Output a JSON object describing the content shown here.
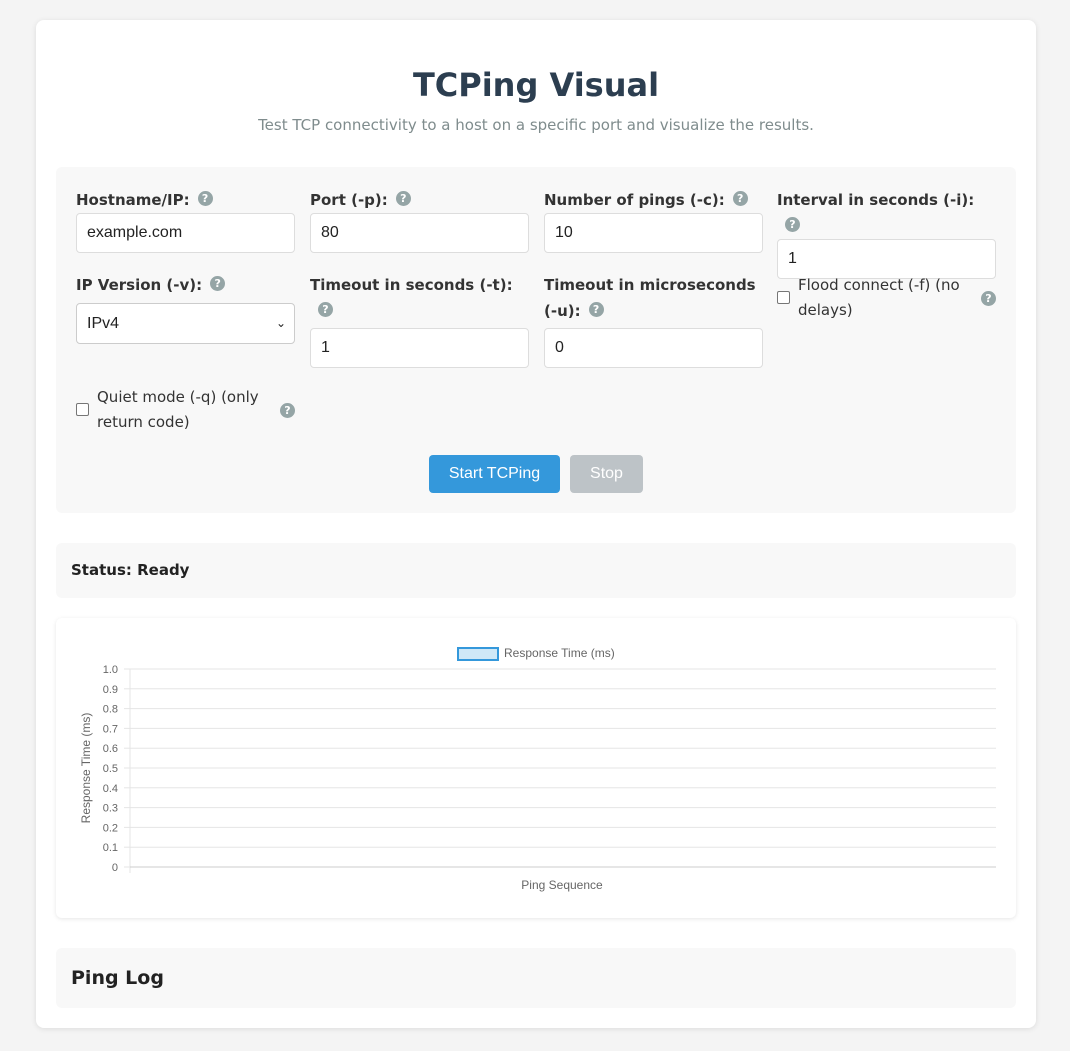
{
  "header": {
    "title": "TCPing Visual",
    "subtitle": "Test TCP connectivity to a host on a specific port and visualize the results."
  },
  "form": {
    "hostname": {
      "label": "Hostname/IP:",
      "value": "example.com"
    },
    "port": {
      "label": "Port (-p):",
      "value": "80"
    },
    "count": {
      "label": "Number of pings (-c):",
      "value": "10"
    },
    "interval": {
      "label": "Interval in seconds (-i):",
      "value": "1"
    },
    "ip_version": {
      "label": "IP Version (-v):",
      "selected": "IPv4"
    },
    "timeout_s": {
      "label": "Timeout in seconds (-t):",
      "value": "1"
    },
    "timeout_us": {
      "label": "Timeout in microseconds (-u):",
      "value": "0"
    },
    "flood": {
      "label": "Flood connect (-f) (no delays)",
      "checked": false
    },
    "quiet": {
      "label": "Quiet mode (-q) (only return code)",
      "checked": false
    },
    "help_glyph": "?",
    "select_chevron": "⌄"
  },
  "buttons": {
    "start": "Start TCPing",
    "stop": "Stop"
  },
  "status": {
    "text": "Status: Ready"
  },
  "log": {
    "title": "Ping Log"
  },
  "colors": {
    "primary": "#3498db",
    "disabled": "#bdc3c7",
    "help": "#95a5a6",
    "title": "#2c3e50",
    "series_fill": "#cfe8f7",
    "series_stroke": "#3498db"
  },
  "chart_data": {
    "type": "line",
    "legend": "Response Time (ms)",
    "legend_position": "top",
    "xlabel": "Ping Sequence",
    "ylabel": "Response Time (ms)",
    "ylim": [
      0,
      1.0
    ],
    "y_ticks": [
      "0",
      "0.1",
      "0.2",
      "0.3",
      "0.4",
      "0.5",
      "0.6",
      "0.7",
      "0.8",
      "0.9",
      "1.0"
    ],
    "x": [],
    "series": [
      {
        "name": "Response Time (ms)",
        "values": []
      }
    ],
    "grid": true
  }
}
